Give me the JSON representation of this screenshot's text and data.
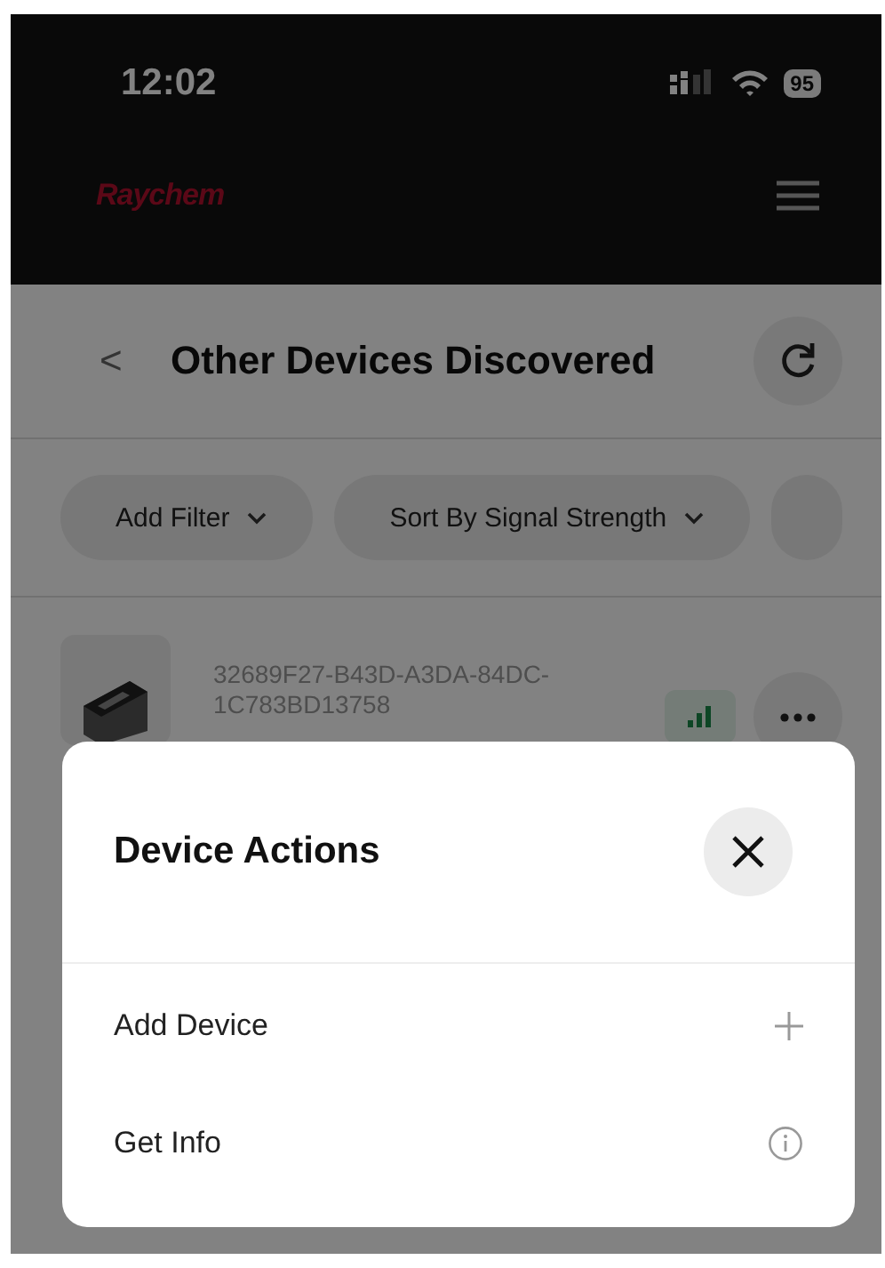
{
  "status_bar": {
    "time": "12:02",
    "battery": "95"
  },
  "header": {
    "logo": "Raychem"
  },
  "nav": {
    "back": "<",
    "title": "Other Devices Discovered"
  },
  "filters": [
    {
      "label": "Add Filter"
    },
    {
      "label": "Sort By Signal Strength"
    }
  ],
  "devices": [
    {
      "id": "32689F27-B43D-A3DA-84DC-1C783BD13758"
    }
  ],
  "sheet": {
    "title": "Device Actions",
    "actions": [
      {
        "label": "Add Device",
        "kind": "add"
      },
      {
        "label": "Get Info",
        "kind": "info"
      }
    ]
  }
}
